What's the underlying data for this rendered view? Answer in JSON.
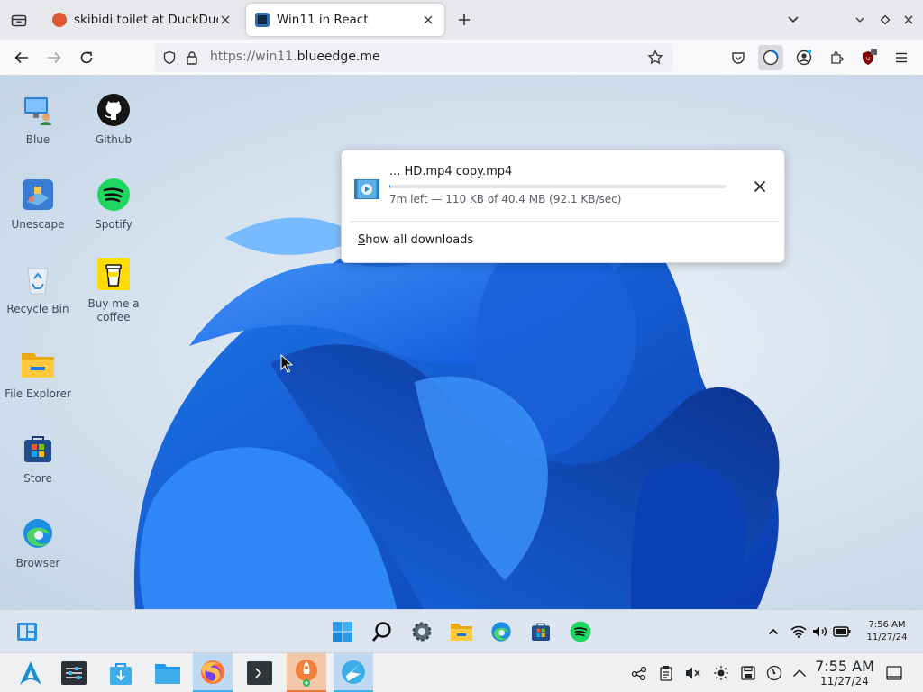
{
  "browser": {
    "tabs": [
      {
        "title": "skibidi toilet at DuckDuckG",
        "active": false
      },
      {
        "title": "Win11 in React",
        "active": true
      }
    ],
    "url": {
      "scheme": "https://win11.",
      "host": "blueedge.me"
    },
    "colors": {
      "accent": "#0061e0",
      "tabstrip": "#e8e8ed"
    }
  },
  "downloads_panel": {
    "file_name": "... HD.mp4 copy.mp4",
    "status": "7m left — 110 KB of 40.4 MB (92.1 KB/sec)",
    "progress_fraction": 0.003,
    "show_all_label": "Show all downloads",
    "show_all_accesskey": "S",
    "show_all_rest": "how all downloads"
  },
  "desktop": {
    "icons": [
      {
        "label": "Blue",
        "icon": "monitor-user-icon"
      },
      {
        "label": "Github",
        "icon": "github-icon"
      },
      {
        "label": "Unescape",
        "icon": "unescape-game-icon"
      },
      {
        "label": "Spotify",
        "icon": "spotify-icon"
      },
      {
        "label": "Recycle Bin",
        "icon": "recycle-bin-icon"
      },
      {
        "label": "Buy me a coffee",
        "icon": "coffee-cup-icon"
      },
      {
        "label": "File Explorer",
        "icon": "folder-icon"
      },
      {
        "label": "Store",
        "icon": "store-icon"
      },
      {
        "label": "Browser",
        "icon": "edge-icon"
      }
    ]
  },
  "win_taskbar": {
    "items": [
      "widgets-icon",
      "start-icon",
      "search-icon",
      "settings-icon",
      "file-explorer-icon",
      "edge-icon",
      "store-icon",
      "spotify-icon"
    ],
    "clock": {
      "time": "7:56 AM",
      "date": "11/27/24"
    }
  },
  "host_panel": {
    "clock": {
      "time": "7:55 AM",
      "date": "11/27/24"
    },
    "tasks": [
      "arch-launcher-icon",
      "system-settings-icon",
      "discover-icon",
      "dolphin-icon",
      "firefox-icon",
      "terminal-icon",
      "updater-icon",
      "browser-globe-icon"
    ]
  }
}
